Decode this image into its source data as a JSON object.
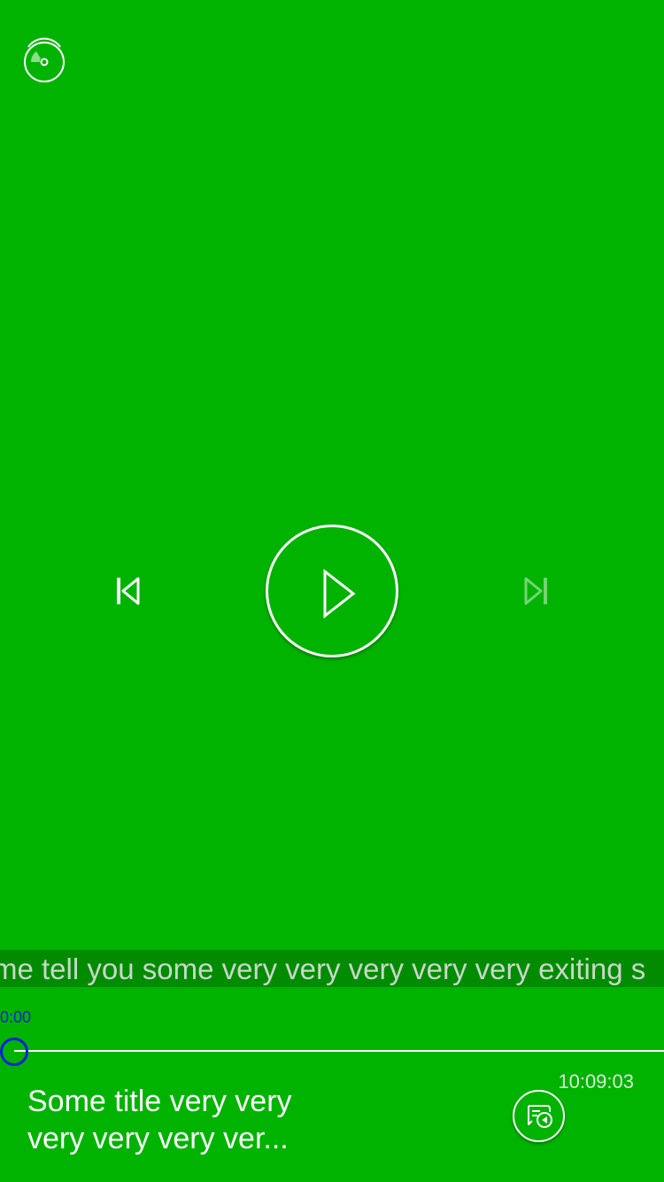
{
  "top_bar": {
    "source_icon": "disc-wave-icon"
  },
  "controls": {
    "previous_icon": "skip-previous-icon",
    "play_icon": "play-icon",
    "next_icon": "skip-next-icon",
    "next_enabled": false
  },
  "ticker": {
    "text": "me tell you some very very very very very exiting s"
  },
  "progress": {
    "elapsed_label": "0:00",
    "fraction": 0
  },
  "now_playing": {
    "title": "Some title very very very very very ver...",
    "time": "10:09:03",
    "playlist_icon": "playlist-play-icon"
  },
  "colors": {
    "background": "#00b300",
    "foreground": "#ffffff",
    "progress_accent": "#0a1fd8"
  }
}
